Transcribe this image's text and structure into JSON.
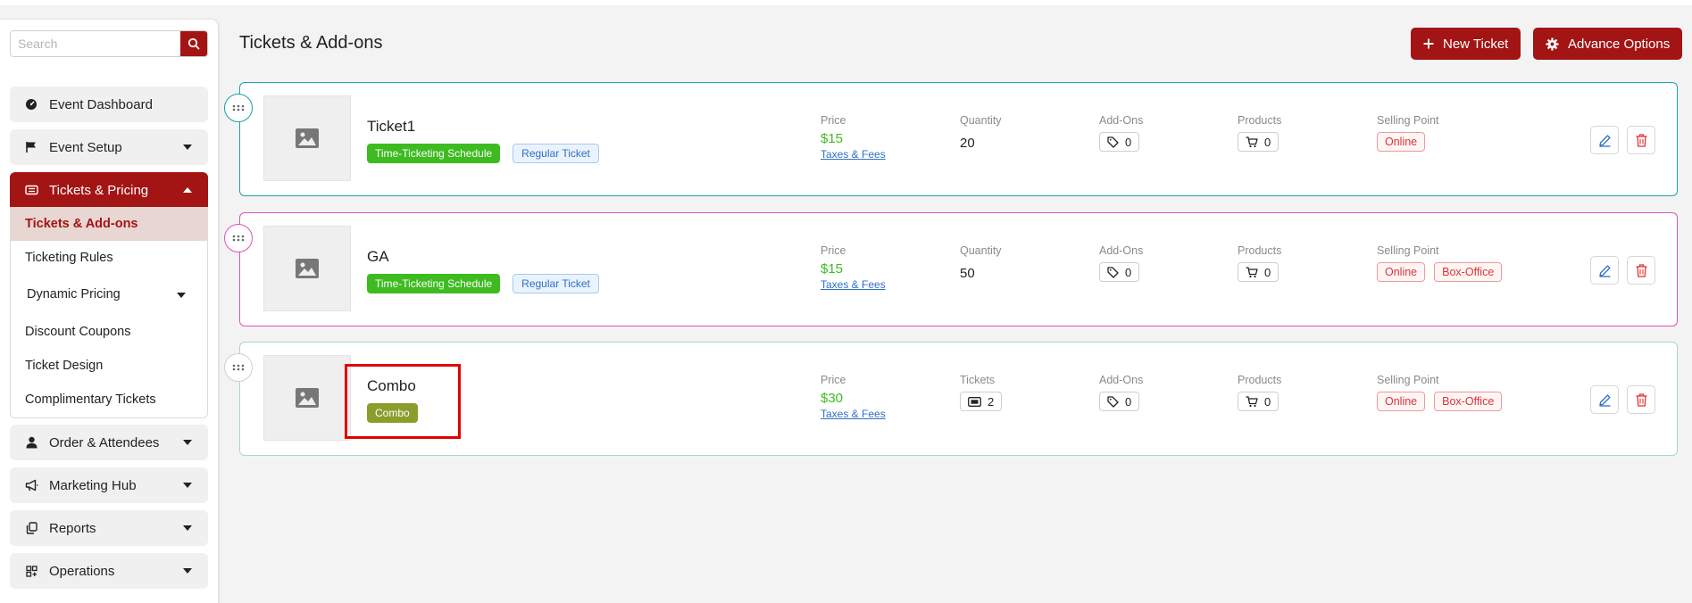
{
  "sidebar": {
    "search_placeholder": "Search",
    "nav": {
      "event_dashboard": "Event Dashboard",
      "event_setup": "Event Setup",
      "tickets_pricing": "Tickets & Pricing",
      "order_attendees": "Order & Attendees",
      "marketing_hub": "Marketing Hub",
      "reports": "Reports",
      "operations": "Operations"
    },
    "submenu": [
      "Tickets & Add-ons",
      "Ticketing Rules",
      "Dynamic Pricing",
      "Discount Coupons",
      "Ticket Design",
      "Complimentary Tickets"
    ],
    "active_submenu": "Tickets & Add-ons"
  },
  "header": {
    "title": "Tickets & Add-ons",
    "new_ticket": "New Ticket",
    "advance_options": "Advance Options"
  },
  "labels": {
    "price": "Price",
    "quantity": "Quantity",
    "tickets": "Tickets",
    "addons": "Add-Ons",
    "products": "Products",
    "selling_point": "Selling Point",
    "taxes_fees": "Taxes & Fees"
  },
  "tickets": [
    {
      "name": "Ticket1",
      "tags": [
        "Time-Ticketing Schedule",
        "Regular Ticket"
      ],
      "price": "$15",
      "quantity": "20",
      "addons": "0",
      "products": "0",
      "selling_points": [
        "Online"
      ],
      "accent": "#1aa3a8"
    },
    {
      "name": "GA",
      "tags": [
        "Time-Ticketing Schedule",
        "Regular Ticket"
      ],
      "price": "$15",
      "quantity": "50",
      "addons": "0",
      "products": "0",
      "selling_points": [
        "Online",
        "Box-Office"
      ],
      "accent": "#e052b8"
    },
    {
      "name": "Combo",
      "tags": [
        "Combo"
      ],
      "price": "$30",
      "tickets": "2",
      "addons": "0",
      "products": "0",
      "selling_points": [
        "Online",
        "Box-Office"
      ],
      "accent": "#a8d8c4"
    }
  ],
  "colors": {
    "brand": "#a31414",
    "green": "#3dbb20",
    "olive": "#8a9e2c",
    "highlight": "#e10000"
  }
}
